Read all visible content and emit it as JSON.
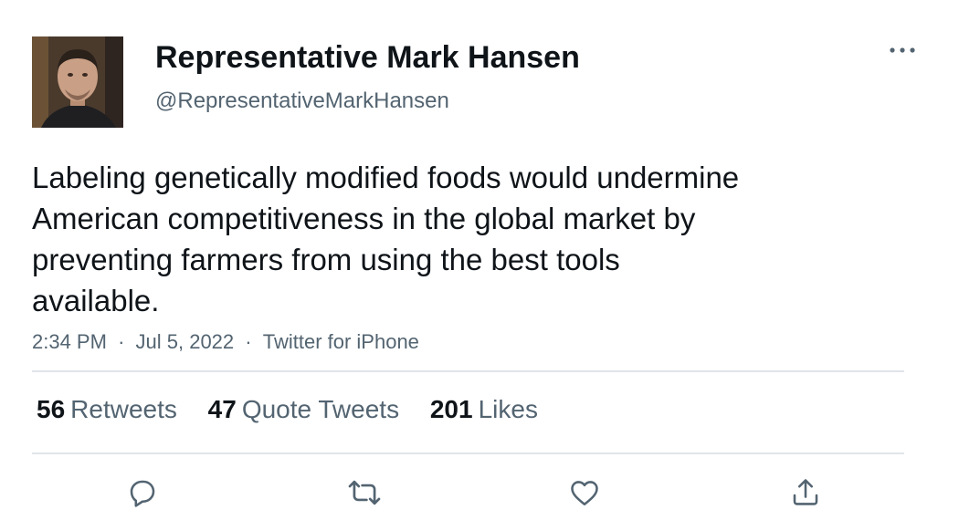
{
  "author": {
    "display_name": "Representative Mark Hansen",
    "handle": "@RepresentativeMarkHansen",
    "avatar_icon": "profile-photo"
  },
  "tweet": {
    "text_lines": [
      "Labeling genetically modified foods would undermine",
      "American competitiveness in the global market by",
      "preventing farmers from using the best tools",
      "available."
    ],
    "time": "2:34 PM",
    "date": "Jul 5, 2022",
    "source": "Twitter for iPhone",
    "separator": "·"
  },
  "stats": {
    "retweets": {
      "count": "56",
      "label": "Retweets"
    },
    "quote_tweets": {
      "count": "47",
      "label": "Quote Tweets"
    },
    "likes": {
      "count": "201",
      "label": "Likes"
    }
  },
  "actions": {
    "reply_icon": "reply-icon",
    "retweet_icon": "retweet-icon",
    "like_icon": "heart-icon",
    "share_icon": "share-icon"
  },
  "colors": {
    "text": "#0f1419",
    "secondary": "#536471",
    "divider": "#e1e5e8",
    "icon": "#536471"
  }
}
